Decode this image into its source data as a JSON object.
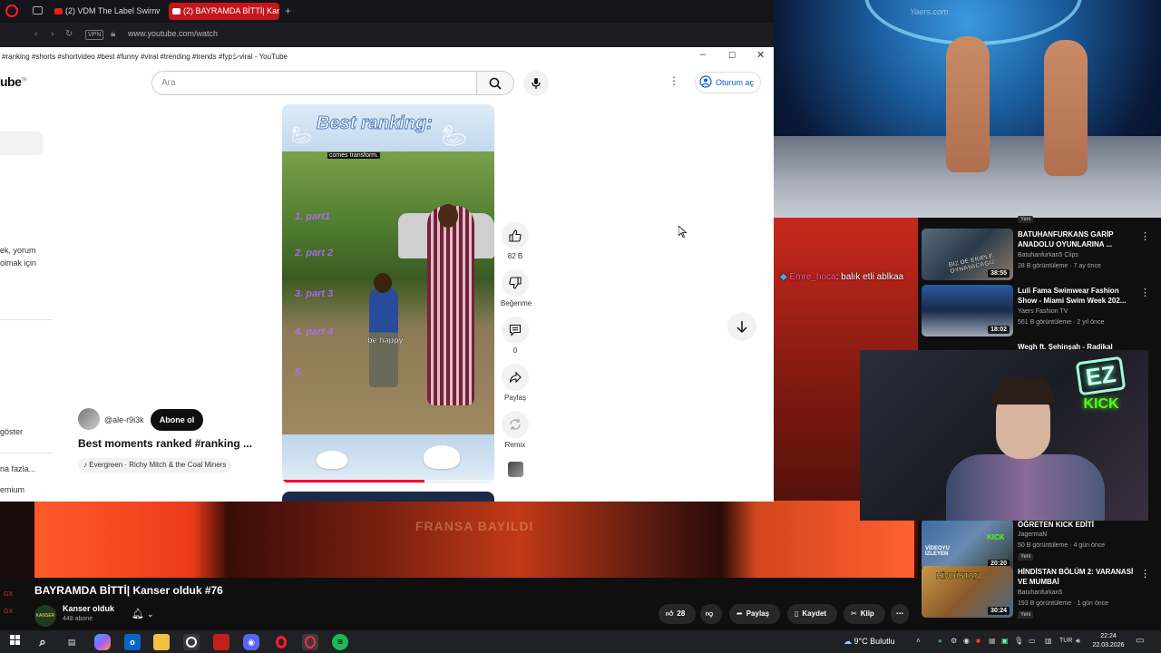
{
  "browser": {
    "tabs": [
      {
        "label": "(2) VDM The Label Swimw",
        "active": false
      },
      {
        "label": "(2) BAYRAMDA BİTTİ| Kan",
        "active": true
      }
    ],
    "vpn_label": "VPN",
    "url": "www.youtube.com/watch"
  },
  "yt_window": {
    "title": "#ranking #shorts #shortvideo #best #funny #viral #trending #trends #fypシviral - YouTube",
    "logo_text": "ube",
    "logo_region": "TR",
    "search_placeholder": "Ara",
    "signin_label": "Oturum aç",
    "left_snippets": [
      "ek, yorum",
      "olmak için",
      "göster",
      "na fazla...",
      "emium"
    ],
    "short": {
      "header_text": "Best ranking:",
      "caption": "comes transform.",
      "ranks": [
        "1. part1",
        "2. part 2",
        "3. part 3",
        "4. part 4",
        "5."
      ],
      "overlay_text": "be happy.",
      "progress": 0.67
    },
    "actions": {
      "like_count": "82 B",
      "dislike_label": "Beğenme",
      "comment_count": "0",
      "share_label": "Paylaş",
      "remix_label": "Remix"
    },
    "channel": "@ale-r9i3k",
    "subscribe_label": "Abone ol",
    "short_title": "Best moments ranked #ranking ...",
    "music": "Evergreen · Richy Mitch & the Coal Miners"
  },
  "stream": {
    "runway_logo": "Yaers.com",
    "chat": {
      "user": "Emre_hoca",
      "message": ": balık etli ablkaa"
    },
    "neon_ez": "EZ",
    "neon_kick": "KICK",
    "blur_watermark": "FRANSA BAYILDI",
    "title": "BAYRAMDA BİTTİ| Kanser olduk #76",
    "channel": "Kanser olduk",
    "avatar_text": "KANSER OLDUK",
    "subscribers": "448 abone",
    "like_count": "28",
    "share_label": "Paylaş",
    "save_label": "Kaydet",
    "clip_label": "Klip",
    "side_glyph_1": "GX",
    "side_glyph_2": "GX",
    "top_badge": "Yeni"
  },
  "recommendations": [
    {
      "title": "BATUHANFURKANS GARİP ANADOLU OYUNLARINA ...",
      "channel": "Batuhanfurkan5 Clips",
      "meta": "28 B görüntüleme · 7 ay önce",
      "duration": "38:55",
      "badge": "",
      "thumb_text": "BİZ DE EKİPLE OYNAYACAĞIZ"
    },
    {
      "title": "Luli Fama Swimwear Fashion Show - Miami Swim Week 202...",
      "channel": "Yaers Fashion TV",
      "meta": "561 B görüntüleme · 2 yıl önce",
      "duration": "18:02",
      "badge": "",
      "thumb_text": ""
    },
    {
      "title": "Wegh ft. Şehinşah - Radikal",
      "channel": "",
      "meta": "",
      "duration": "",
      "badge": "",
      "thumb_text": ""
    },
    {
      "title": "ÖĞRETEN KICK EDİTİ",
      "channel": "JagermaN",
      "meta": "50 B görüntüleme · 4 gün önce",
      "duration": "20:20",
      "badge": "Yeni",
      "thumb_text": "VİDEOYU İZLEYEN"
    },
    {
      "title": "HİNDİSTAN BÖLÜM 2: VARANASİ VE MUMBAİ",
      "channel": "Batuhanfurkan5",
      "meta": "193 B görüntüleme · 1 gün önce",
      "duration": "30:24",
      "badge": "Yeni",
      "thumb_text": "HİNDİSTAN"
    }
  ],
  "taskbar": {
    "weather": "9°C  Bulutlu",
    "lang": "TUR",
    "time": "22:24",
    "date": "22.03.2026"
  },
  "colors": {
    "accent_red": "#c5161d",
    "yt_blue": "#065fd4",
    "kick_green": "#53fc18"
  }
}
